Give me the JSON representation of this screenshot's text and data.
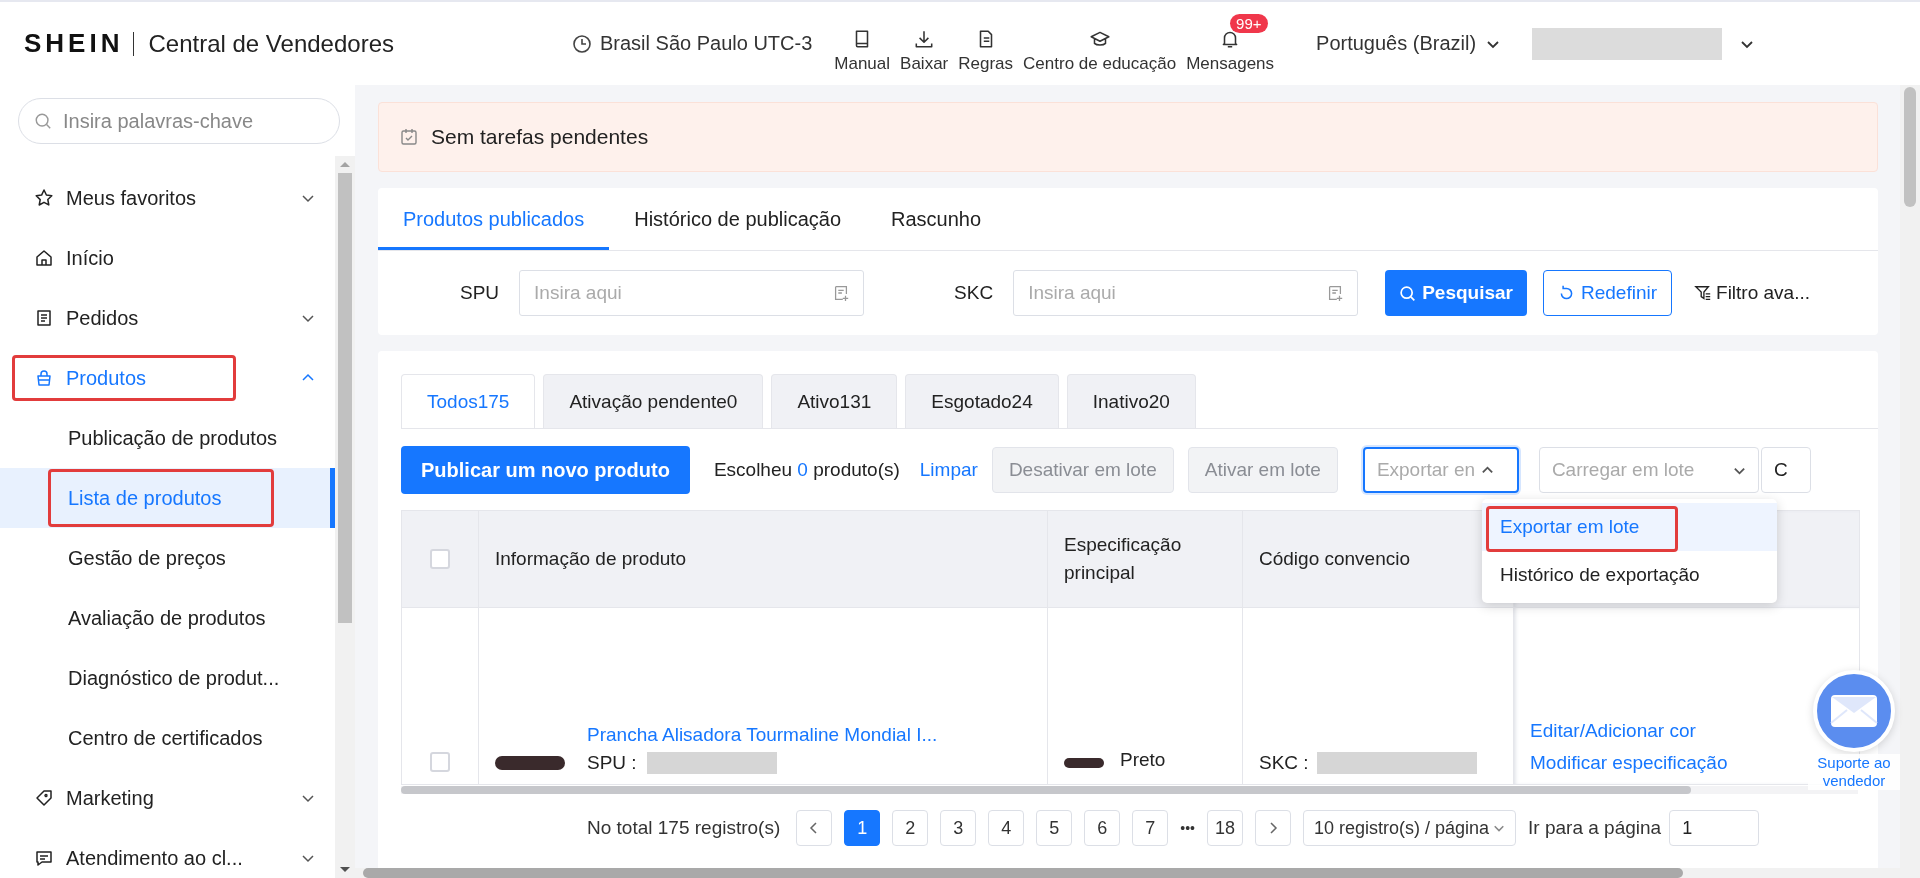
{
  "header": {
    "logo": "SHEIN",
    "title": "Central de Vendedores",
    "timezone": "Brasil São Paulo UTC-3",
    "nav": [
      {
        "label": "Manual"
      },
      {
        "label": "Baixar"
      },
      {
        "label": "Regras"
      },
      {
        "label": "Centro de educação"
      },
      {
        "label": "Mensagens",
        "badge": "99+"
      }
    ],
    "language": "Português (Brazil)"
  },
  "sidebar": {
    "search": {
      "placeholder": "Insira palavras-chave"
    },
    "items": [
      {
        "label": "Meus favoritos",
        "selected": false,
        "expanded": false,
        "collapsible": true,
        "highlighted": false
      },
      {
        "label": "Início",
        "selected": false,
        "expanded": false,
        "collapsible": false,
        "highlighted": false
      },
      {
        "label": "Pedidos",
        "selected": false,
        "expanded": false,
        "collapsible": true,
        "highlighted": false
      },
      {
        "label": "Produtos",
        "selected": true,
        "expanded": true,
        "collapsible": true,
        "highlighted": true,
        "children": [
          {
            "label": "Publicação de produtos",
            "selected": false,
            "highlighted": false
          },
          {
            "label": "Lista de produtos",
            "selected": true,
            "highlighted": true
          },
          {
            "label": "Gestão de preços",
            "selected": false,
            "highlighted": false
          },
          {
            "label": "Avaliação de produtos",
            "selected": false,
            "highlighted": false
          },
          {
            "label": "Diagnóstico de produt...",
            "selected": false,
            "highlighted": false
          },
          {
            "label": "Centro de certificados",
            "selected": false,
            "highlighted": false
          }
        ]
      },
      {
        "label": "Marketing",
        "selected": false,
        "expanded": false,
        "collapsible": true,
        "highlighted": false
      },
      {
        "label": "Atendimento ao cl...",
        "selected": false,
        "expanded": false,
        "collapsible": true,
        "highlighted": false
      }
    ]
  },
  "alert": {
    "text": "Sem tarefas pendentes"
  },
  "page_tabs": [
    {
      "label": "Produtos publicados",
      "selected": true
    },
    {
      "label": "Histórico de publicação",
      "selected": false
    },
    {
      "label": "Rascunho",
      "selected": false
    }
  ],
  "search": {
    "fields": [
      {
        "label": "SPU",
        "placeholder": "Insira aqui"
      },
      {
        "label": "SKC",
        "placeholder": "Insira aqui"
      }
    ],
    "search_button": "Pesquisar",
    "reset_button": "Redefinir",
    "filter_button": "Filtro ava..."
  },
  "status_tabs": [
    {
      "label": "Todos175",
      "selected": true
    },
    {
      "label": "Ativação pendente0",
      "selected": false
    },
    {
      "label": "Ativo131",
      "selected": false
    },
    {
      "label": "Esgotado24",
      "selected": false
    },
    {
      "label": "Inativo20",
      "selected": false
    }
  ],
  "actions": {
    "publish_button": "Publicar um novo produto",
    "selection_prefix": "Escolheu",
    "selection_count": "0",
    "selection_suffix": "produto(s)",
    "clear_link": "Limpar",
    "batch_buttons": [
      {
        "label": "Desativar em lote",
        "disabled": true
      },
      {
        "label": "Ativar em lote",
        "disabled": true
      }
    ],
    "export_select": {
      "value": "Exportar en",
      "open": true,
      "options": [
        {
          "label": "Exportar em lote",
          "selected": true,
          "highlighted": true
        },
        {
          "label": "Histórico de exportação",
          "selected": false,
          "highlighted": false
        }
      ]
    },
    "upload_select": {
      "value": "Carregar em lote"
    },
    "cut_button": "C"
  },
  "table": {
    "header_checked": false,
    "columns": [
      "Informação de produto",
      "Especificação principal",
      "Código convencio"
    ],
    "rows": [
      {
        "checked": false,
        "title": "Prancha Alisadora Tourmaline Mondial I...",
        "spu_label": "SPU :",
        "spec": "Preto",
        "skc_label": "SKC :",
        "actions": [
          "Editar/Adicionar cor",
          "Modificar especificação"
        ]
      }
    ]
  },
  "pagination": {
    "total": "No total 175 registro(s)",
    "pages": [
      {
        "kind": "page",
        "label": "1",
        "selected": true
      },
      {
        "kind": "page",
        "label": "2",
        "selected": false
      },
      {
        "kind": "page",
        "label": "3",
        "selected": false
      },
      {
        "kind": "page",
        "label": "4",
        "selected": false
      },
      {
        "kind": "page",
        "label": "5",
        "selected": false
      },
      {
        "kind": "page",
        "label": "6",
        "selected": false
      },
      {
        "kind": "page",
        "label": "7",
        "selected": false
      },
      {
        "kind": "ellipsis",
        "label": "•••"
      },
      {
        "kind": "page",
        "label": "18",
        "selected": false
      }
    ],
    "page_size": "10 registro(s) / página",
    "jump_label": "Ir para a página",
    "jump_value": "1"
  },
  "support": {
    "label": "Suporte ao vendedor"
  }
}
